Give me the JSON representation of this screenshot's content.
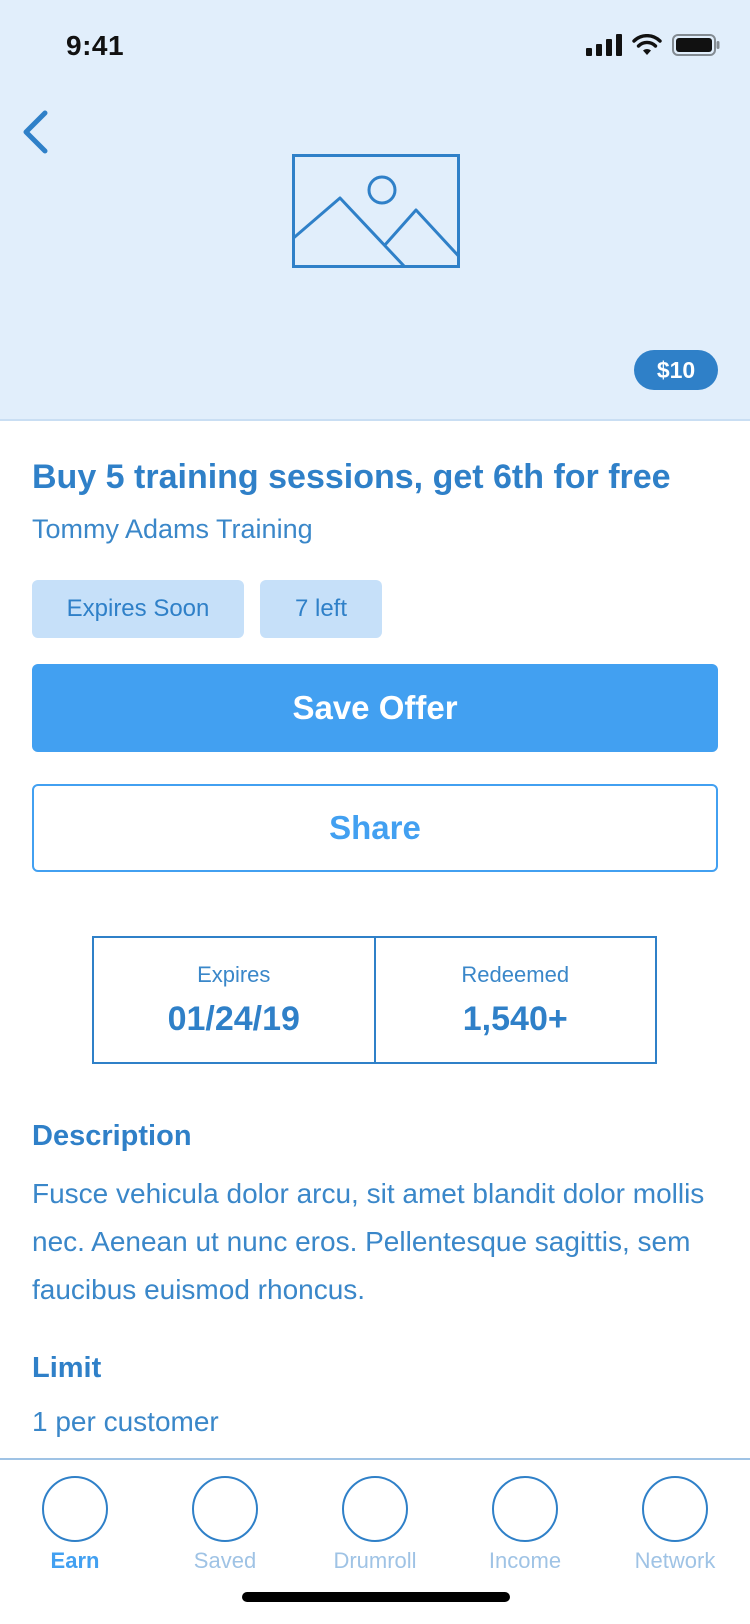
{
  "status_bar": {
    "time": "9:41"
  },
  "hero": {
    "price_badge": "$10"
  },
  "offer": {
    "title": "Buy 5 training sessions, get 6th for free",
    "merchant": "Tommy Adams Training",
    "tags": [
      "Expires Soon",
      "7 left"
    ]
  },
  "actions": {
    "save_label": "Save Offer",
    "share_label": "Share"
  },
  "stats": [
    {
      "label": "Expires",
      "value": "01/24/19"
    },
    {
      "label": "Redeemed",
      "value": "1,540+"
    }
  ],
  "description": {
    "heading": "Description",
    "text": "Fusce vehicula dolor arcu, sit amet blandit dolor mollis nec. Aenean ut nunc eros. Pellentesque sagittis, sem faucibus euismod rhoncus."
  },
  "limit": {
    "heading": "Limit",
    "text": "1 per customer"
  },
  "tab_bar": {
    "active": "Earn",
    "tabs": [
      {
        "label": "Earn"
      },
      {
        "label": "Saved"
      },
      {
        "label": "Drumroll"
      },
      {
        "label": "Income"
      },
      {
        "label": "Network"
      }
    ]
  },
  "colors": {
    "primary": "#2f80c8",
    "button_blue": "#42a0f1",
    "hero_bg": "#e1eefb",
    "tag_bg": "#c6e0f9",
    "inactive_tab": "#9fc3e5"
  },
  "icons": [
    "back-chevron-icon",
    "image-placeholder-icon",
    "cellular-signal-icon",
    "wifi-icon",
    "battery-icon"
  ]
}
